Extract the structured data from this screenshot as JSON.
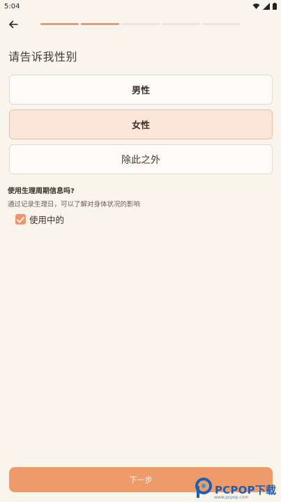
{
  "status_bar": {
    "time": "5:04"
  },
  "progress": {
    "total": 5,
    "done": 2
  },
  "title": "请告诉我性别",
  "options": [
    {
      "label": "男性",
      "selected": false
    },
    {
      "label": "女性",
      "selected": true
    },
    {
      "label": "除此之外",
      "selected": false
    }
  ],
  "cycle": {
    "question": "使用生理周期信息吗?",
    "description": "通过记录生理日，可以了解对身体状况的影响",
    "checkbox_label": "使用中的",
    "checked": true
  },
  "next_button": "下一步",
  "watermark": {
    "text": "PCPOP下载",
    "sub": "www.pcpop.com"
  },
  "colors": {
    "accent": "#ee9a69",
    "selected_bg": "#fbe6d8",
    "background": "#faf5ec"
  }
}
